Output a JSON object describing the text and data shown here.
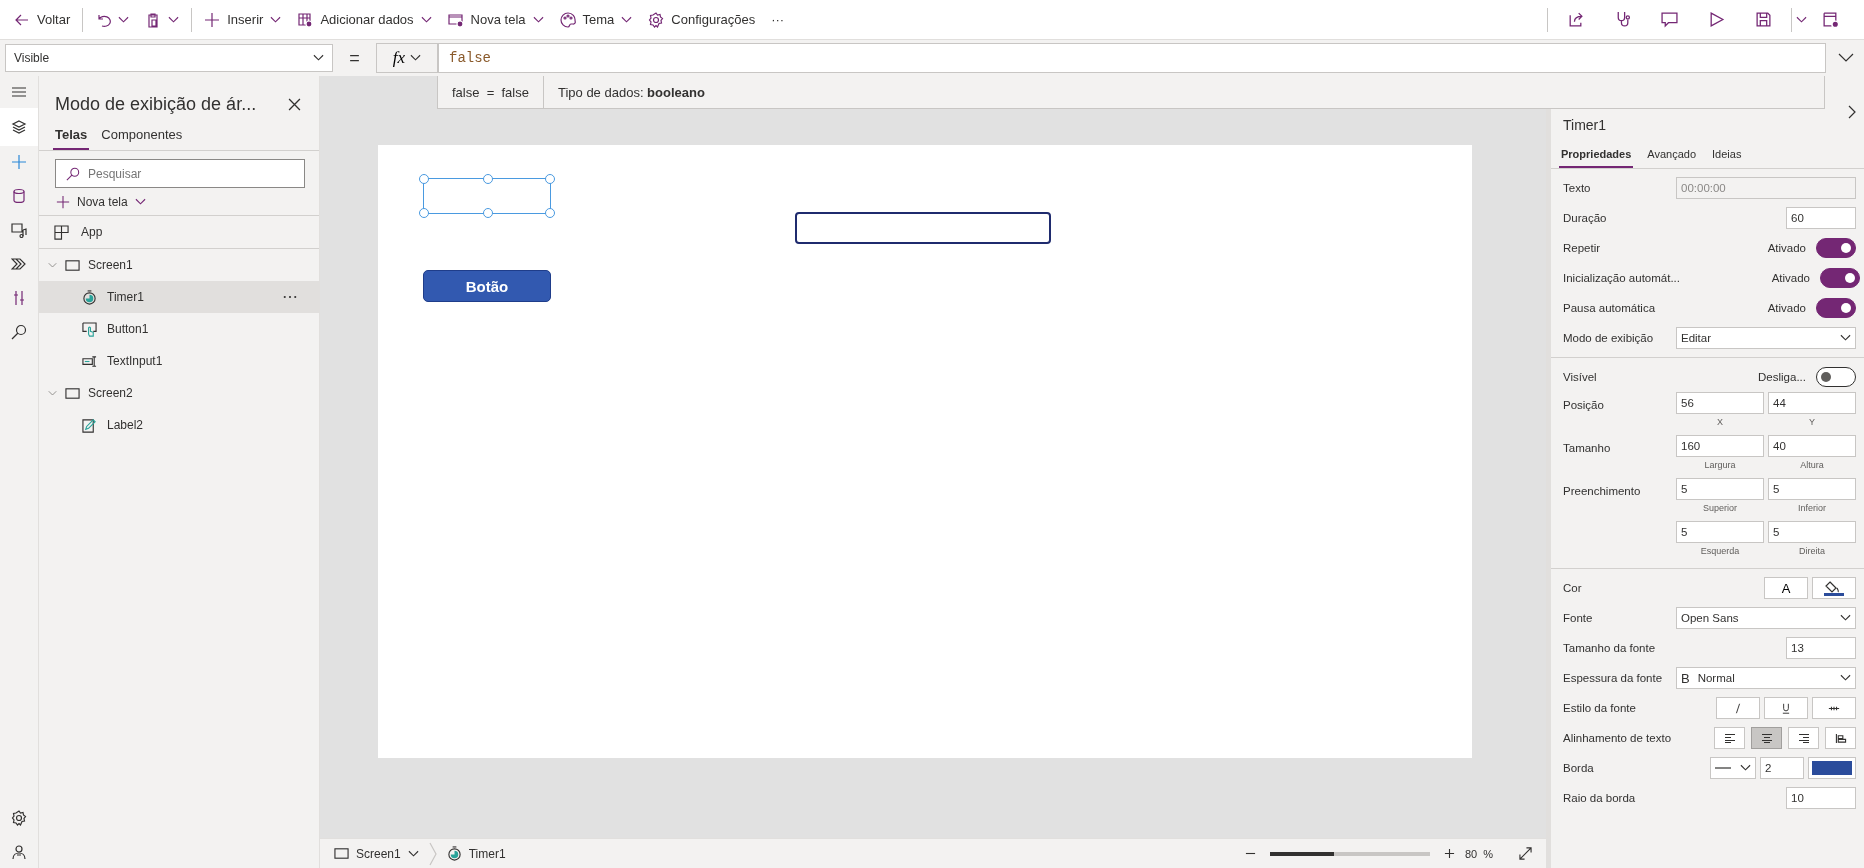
{
  "toolbar": {
    "items": [
      {
        "kind": "back",
        "label": "Voltar"
      },
      {
        "kind": "undo"
      },
      {
        "kind": "paste"
      },
      {
        "kind": "insert",
        "label": "Inserir"
      },
      {
        "kind": "data",
        "label": "Adicionar dados"
      },
      {
        "kind": "screen",
        "label": "Nova tela"
      },
      {
        "kind": "theme",
        "label": "Tema"
      },
      {
        "kind": "settings",
        "label": "Configurações"
      },
      {
        "kind": "more",
        "label": "···"
      }
    ]
  },
  "formula_bar": {
    "property": "Visible",
    "equals": "=",
    "fx": "fx",
    "formula": "false",
    "hint_expression": "false  =  false",
    "hint_type": "Tipo de dados: **booleano**"
  },
  "tree_panel": {
    "title": "Modo de exibição de ár...",
    "tabs": [
      {
        "label": "Telas",
        "selected": true
      },
      {
        "label": "Componentes",
        "selected": false
      }
    ],
    "search": {
      "placeholder": "Pesquisar"
    },
    "new_screen": "Nova tela",
    "items": [
      {
        "kind": "app",
        "label": "App"
      },
      {
        "kind": "screen",
        "label": "Screen1",
        "expanded": true,
        "children": [
          {
            "kind": "timer",
            "label": "Timer1",
            "selected": true
          },
          {
            "kind": "button",
            "label": "Button1",
            "selected": false
          },
          {
            "kind": "textinput",
            "label": "TextInput1",
            "selected": false
          }
        ]
      },
      {
        "kind": "screen",
        "label": "Screen2",
        "expanded": true,
        "children": [
          {
            "kind": "label",
            "label": "Label2",
            "selected": false
          }
        ]
      }
    ]
  },
  "canvas": {
    "button_label": "Botão"
  },
  "properties": {
    "title": "Timer1",
    "tabs": [
      {
        "label": "Propriedades",
        "selected": true
      },
      {
        "label": "Avançado",
        "selected": false
      },
      {
        "label": "Ideias",
        "selected": false
      }
    ],
    "sections": [
      {
        "rows": [
          {
            "kind": "readonly",
            "label": "Texto",
            "value": "00:00:00"
          },
          {
            "kind": "number",
            "label": "Duração",
            "value": "60"
          },
          {
            "kind": "toggle",
            "label": "Repetir",
            "state_text": "Ativado",
            "on": true
          },
          {
            "kind": "toggle",
            "label": "Inicialização automát...",
            "state_text": "Ativado",
            "on": true
          },
          {
            "kind": "toggle",
            "label": "Pausa automática",
            "state_text": "Ativado",
            "on": true
          },
          {
            "kind": "dropdown",
            "label": "Modo de exibição",
            "value": "Editar"
          }
        ]
      },
      {
        "rows": [
          {
            "kind": "toggle",
            "label": "Visível",
            "state_text": "Desliga...",
            "on": false
          },
          {
            "kind": "pair",
            "label": "Posição",
            "fields": [
              {
                "value": "56",
                "caption": "X"
              },
              {
                "value": "44",
                "caption": "Y"
              }
            ]
          },
          {
            "kind": "pair",
            "label": "Tamanho",
            "fields": [
              {
                "value": "160",
                "caption": "Largura"
              },
              {
                "value": "40",
                "caption": "Altura"
              }
            ]
          },
          {
            "kind": "pair",
            "label": "Preenchimento",
            "fields": [
              {
                "value": "5",
                "caption": "Superior"
              },
              {
                "value": "5",
                "caption": "Inferior"
              }
            ]
          },
          {
            "kind": "pair",
            "fields": [
              {
                "value": "5",
                "caption": "Esquerda"
              },
              {
                "value": "5",
                "caption": "Direita"
              }
            ]
          }
        ]
      },
      {
        "rows": [
          {
            "kind": "color",
            "label": "Cor",
            "text_glyph": "A"
          },
          {
            "kind": "dropdown",
            "label": "Fonte",
            "value": "Open Sans"
          },
          {
            "kind": "number",
            "label": "Tamanho da fonte",
            "value": "13"
          },
          {
            "kind": "dropdown",
            "label": "Espessura da fonte",
            "prefix": "B",
            "value": "Normal"
          },
          {
            "kind": "styles",
            "label": "Estilo da fonte"
          },
          {
            "kind": "align",
            "label": "Alinhamento de texto",
            "options": [
              {
                "kind": "left",
                "selected": false
              },
              {
                "kind": "center",
                "selected": true
              },
              {
                "kind": "right",
                "selected": false
              },
              {
                "kind": "top",
                "selected": false
              }
            ]
          },
          {
            "kind": "border",
            "label": "Borda",
            "value": "2"
          },
          {
            "kind": "number",
            "label": "Raio da borda",
            "value": "10"
          }
        ]
      }
    ]
  },
  "status_bar": {
    "crumbs": [
      {
        "kind": "screen",
        "label": "Screen1"
      },
      {
        "kind": "timer",
        "label": "Timer1"
      }
    ],
    "zoom": {
      "level": 0.4,
      "value": "80",
      "unit": "%"
    }
  }
}
